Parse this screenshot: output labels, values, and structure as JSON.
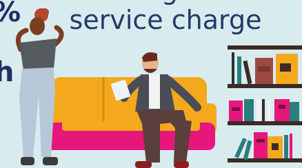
{
  "headline": {
    "line1_partial": "g",
    "line2": "service charge"
  },
  "left_edge": {
    "top_fragment": "%",
    "mid_fragment": "h"
  },
  "colors": {
    "background": "#d8ecef",
    "headline": "#243a68",
    "sofa_body": "#f4a81c",
    "sofa_base": "#e6177b",
    "shelf_wood": "#3d2a25"
  },
  "icons": [
    "woman-figure-illustration",
    "man-reading-document-illustration",
    "sofa-illustration",
    "bookshelf-illustration"
  ]
}
